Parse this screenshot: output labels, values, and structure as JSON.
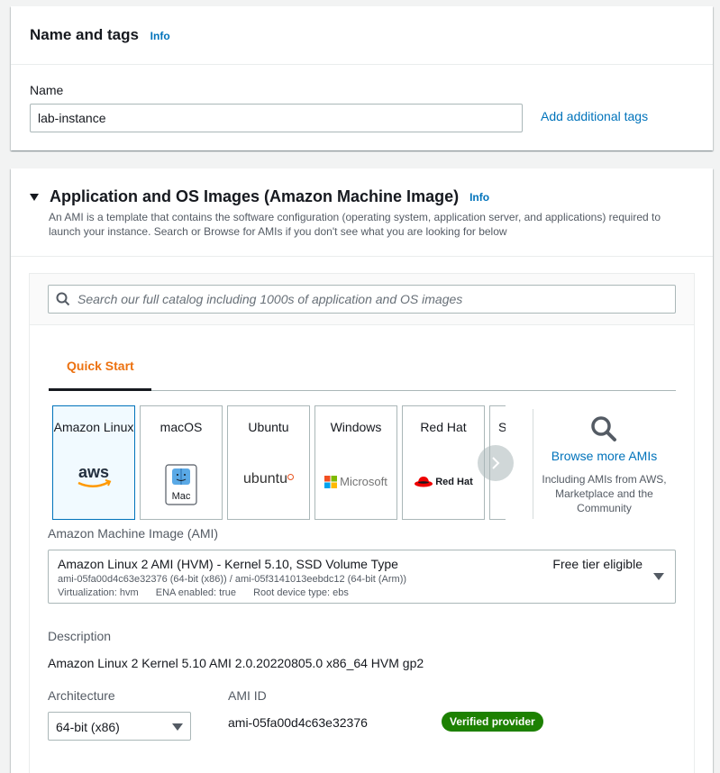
{
  "colors": {
    "link": "#0073bb",
    "accent_orange": "#ec7211",
    "badge_green": "#1d8102",
    "selected_card_border": "#0073bb"
  },
  "name_tags": {
    "title": "Name and tags",
    "info": "Info",
    "name_label": "Name",
    "name_value": "lab-instance",
    "add_tags_link": "Add additional tags"
  },
  "ami_section": {
    "title": "Application and OS Images (Amazon Machine Image)",
    "info": "Info",
    "description": "An AMI is a template that contains the software configuration (operating system, application server, and applications) required to launch your instance. Search or Browse for AMIs if you don't see what you are looking for below",
    "search_placeholder": "Search our full catalog including 1000s of application and OS images",
    "tabs": [
      {
        "label": "Quick Start",
        "active": true
      }
    ],
    "os_cards": [
      {
        "name": "Amazon Linux",
        "logo": "aws-logo",
        "selected": true
      },
      {
        "name": "macOS",
        "logo": "mac-logo",
        "logo_text": "Mac",
        "selected": false
      },
      {
        "name": "Ubuntu",
        "logo": "ubuntu-logo",
        "logo_text": "ubuntu",
        "selected": false
      },
      {
        "name": "Windows",
        "logo": "microsoft-logo",
        "logo_text": "Microsoft",
        "selected": false
      },
      {
        "name": "Red Hat",
        "logo": "redhat-logo",
        "logo_text": "Red Hat",
        "selected": false
      },
      {
        "name": "S",
        "logo": "",
        "selected": false
      }
    ],
    "browse_more": {
      "title": "Browse more AMIs",
      "subtitle": "Including AMIs from AWS, Marketplace and the Community"
    },
    "ami_select": {
      "label": "Amazon Machine Image (AMI)",
      "main": "Amazon Linux 2 AMI (HVM) - Kernel 5.10, SSD Volume Type",
      "ids": "ami-05fa00d4c63e32376 (64-bit (x86)) / ami-05f3141013eebdc12 (64-bit (Arm))",
      "virtualization": "Virtualization: hvm",
      "ena": "ENA enabled: true",
      "root_device": "Root device type: ebs",
      "free_tier": "Free tier eligible"
    },
    "description_label": "Description",
    "description_value": "Amazon Linux 2 Kernel 5.10 AMI 2.0.20220805.0 x86_64 HVM gp2",
    "architecture_label": "Architecture",
    "architecture_value": "64-bit (x86)",
    "ami_id_label": "AMI ID",
    "ami_id_value": "ami-05fa00d4c63e32376",
    "badge": "Verified provider"
  }
}
